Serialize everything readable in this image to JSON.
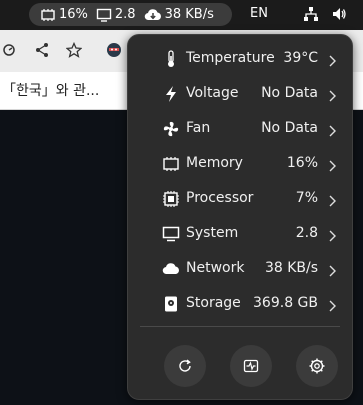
{
  "top_panel": {
    "sysmon": {
      "memory_percent": "16%",
      "system_load": "2.8",
      "network_speed": "38 KB/s"
    },
    "language": "EN"
  },
  "browser": {
    "tab_text": "「한국」와 관..."
  },
  "menu": {
    "items": [
      {
        "label": "Temperature",
        "value": "39°C",
        "icon": "thermometer-icon"
      },
      {
        "label": "Voltage",
        "value": "No Data",
        "icon": "lightning-icon"
      },
      {
        "label": "Fan",
        "value": "No Data",
        "icon": "fan-icon"
      },
      {
        "label": "Memory",
        "value": "16%",
        "icon": "memory-icon"
      },
      {
        "label": "Processor",
        "value": "7%",
        "icon": "processor-icon"
      },
      {
        "label": "System",
        "value": "2.8",
        "icon": "monitor-icon"
      },
      {
        "label": "Network",
        "value": "38 KB/s",
        "icon": "cloud-icon"
      },
      {
        "label": "Storage",
        "value": "369.8 GB",
        "icon": "storage-icon"
      }
    ],
    "actions": [
      "refresh-icon",
      "system-monitor-icon",
      "preferences-icon"
    ]
  }
}
